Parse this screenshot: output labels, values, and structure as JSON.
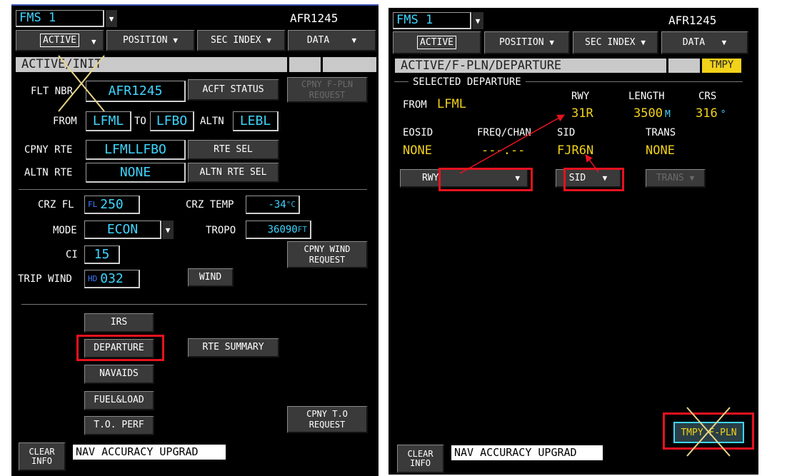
{
  "left": {
    "fms_selector": "FMS 1",
    "flight_id": "AFR1245",
    "menu": [
      {
        "label": "ACTIVE"
      },
      {
        "label": "POSITION"
      },
      {
        "label": "SEC INDEX"
      },
      {
        "label": "DATA"
      }
    ],
    "title": "ACTIVE/INIT",
    "flt_nbr_label": "FLT NBR",
    "flt_nbr_value": "AFR1245",
    "acft_status_button": "ACFT STATUS",
    "cpny_fpln_request_button": "CPNY F-PLN REQUEST",
    "from_label": "FROM",
    "from_value": "LFML",
    "to_label": "TO",
    "to_value": "LFBO",
    "altn_label": "ALTN",
    "altn_value": "LEBL",
    "cpny_rte_label": "CPNY RTE",
    "cpny_rte_value": "LFMLLFBO",
    "rte_sel_button": "RTE SEL",
    "altn_rte_label": "ALTN RTE",
    "altn_rte_value": "NONE",
    "altn_rte_sel_button": "ALTN RTE SEL",
    "crz_fl_label": "CRZ FL",
    "crz_fl_prefix": "FL",
    "crz_fl_value": "250",
    "crz_temp_label": "CRZ TEMP",
    "crz_temp_value": "-34",
    "crz_temp_unit": "°C",
    "mode_label": "MODE",
    "mode_value": "ECON",
    "tropo_label": "TROPO",
    "tropo_value": "36090",
    "tropo_unit": "FT",
    "ci_label": "CI",
    "ci_value": "15",
    "cpny_wind_request_button": "CPNY WIND REQUEST",
    "trip_wind_label": "TRIP WIND",
    "trip_wind_prefix": "HD",
    "trip_wind_value": "032",
    "wind_button": "WIND",
    "irs_button": "IRS",
    "departure_button": "DEPARTURE",
    "rte_summary_button": "RTE SUMMARY",
    "navaids_button": "NAVAIDS",
    "fuel_load_button": "FUEL&LOAD",
    "to_perf_button": "T.O. PERF",
    "cpny_to_request_button": "CPNY T.O REQUEST",
    "clear_info_button": "CLEAR INFO",
    "message": "NAV ACCURACY UPGRAD"
  },
  "right": {
    "fms_selector": "FMS 1",
    "flight_id": "AFR1245",
    "menu": [
      {
        "label": "ACTIVE"
      },
      {
        "label": "POSITION"
      },
      {
        "label": "SEC INDEX"
      },
      {
        "label": "DATA"
      }
    ],
    "title": "ACTIVE/F-PLN/DEPARTURE",
    "tmpy_badge": "TMPY",
    "selected_departure_label": "SELECTED DEPARTURE",
    "from_label": "FROM",
    "from_value": "LFML",
    "rwy_label": "RWY",
    "rwy_value": "31R",
    "length_label": "LENGTH",
    "length_value": "3500",
    "length_unit": "M",
    "crs_label": "CRS",
    "crs_value": "316",
    "crs_unit": "°",
    "eosid_label": "EOSID",
    "eosid_value": "NONE",
    "freq_chan_label": "FREQ/CHAN",
    "freq_chan_value": "---.--",
    "sid_label": "SID",
    "sid_value": "FJR6N",
    "trans_label": "TRANS",
    "trans_value": "NONE",
    "rwy_dropdown": "RWY",
    "sid_dropdown": "SID",
    "trans_dropdown": "TRANS",
    "tmpy_fpln_button": "TMPY F-PLN",
    "clear_info_button": "CLEAR INFO",
    "message": "NAV ACCURACY UPGRAD"
  },
  "colors": {
    "screen_bg": "#000000",
    "cyan": "#3ed6ff",
    "amber": "#f2d21b",
    "button_gray": "#3a3a3a",
    "title_bar": "#c9c9c9",
    "highlight_red": "#e8121f"
  },
  "icons": {
    "dropdown": "triangle-down-icon",
    "cross": "x-cross-icon"
  }
}
